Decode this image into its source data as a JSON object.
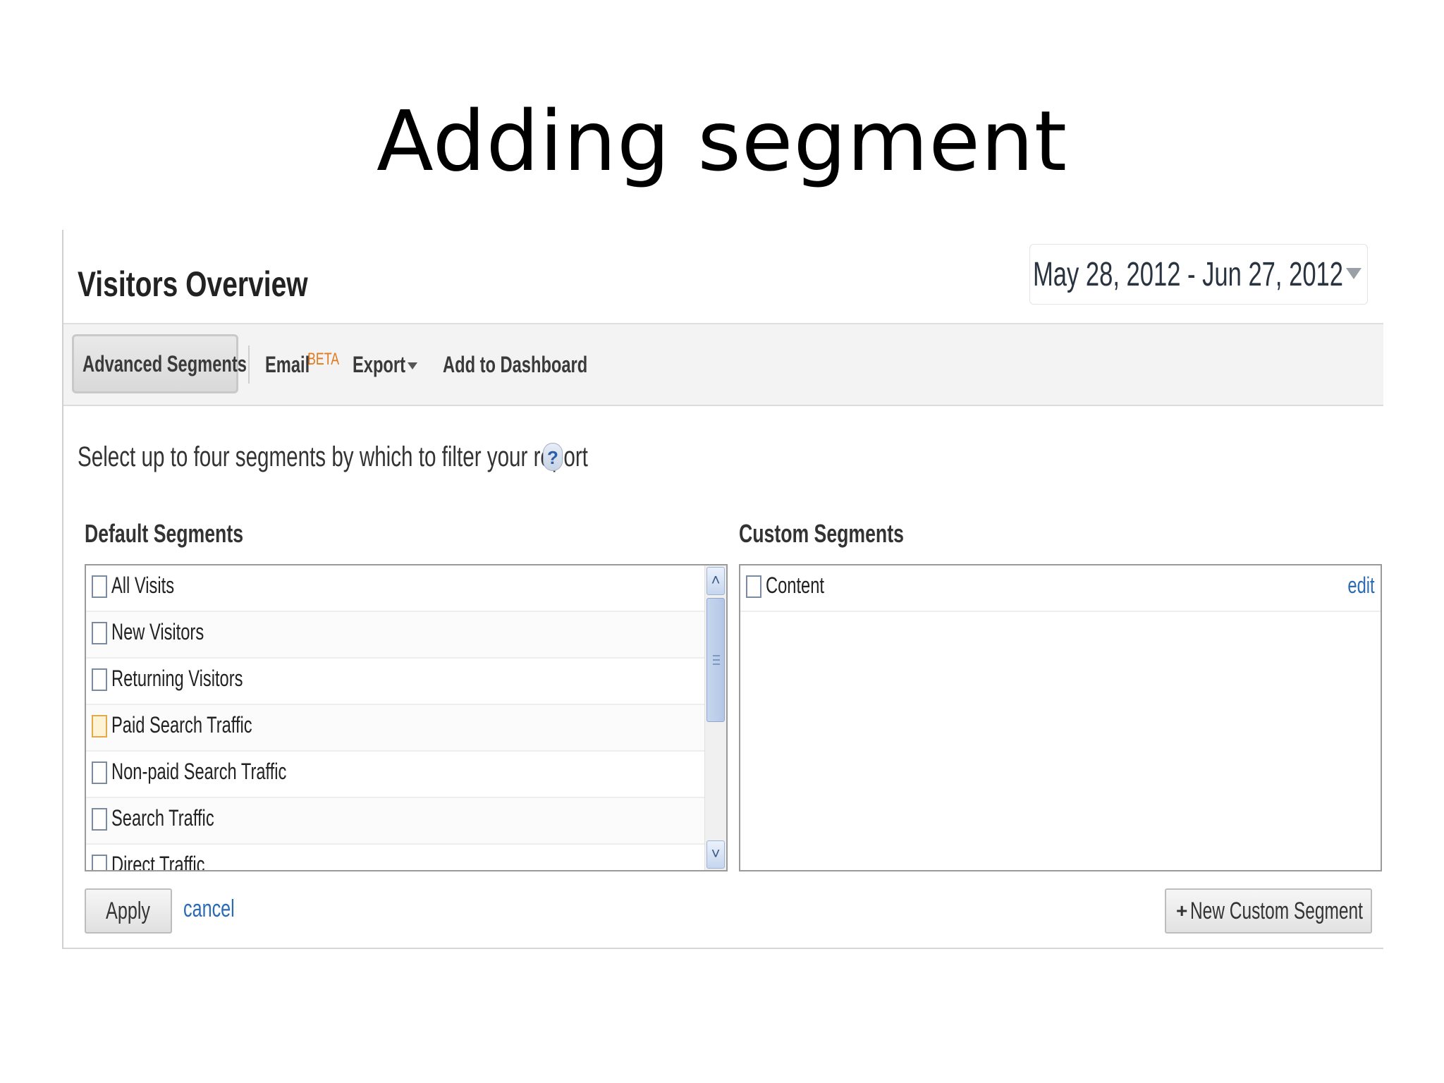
{
  "slide": {
    "title": "Adding segment"
  },
  "header": {
    "page_title": "Visitors Overview",
    "date_range": "May 28, 2012 - Jun 27, 2012"
  },
  "toolbar": {
    "advanced_segments": "Advanced Segments",
    "email": "Email",
    "email_badge": "BETA",
    "export": "Export",
    "add_to_dashboard": "Add to Dashboard"
  },
  "panel": {
    "instructions": "Select up to four segments by which to filter your report",
    "help_icon_glyph": "?",
    "default_label": "Default Segments",
    "custom_label": "Custom Segments",
    "default_segments": [
      {
        "label": "All Visits",
        "checked": false
      },
      {
        "label": "New Visitors",
        "checked": false
      },
      {
        "label": "Returning Visitors",
        "checked": false
      },
      {
        "label": "Paid Search Traffic",
        "checked": false,
        "hover": true
      },
      {
        "label": "Non-paid Search Traffic",
        "checked": false
      },
      {
        "label": "Search Traffic",
        "checked": false
      },
      {
        "label": "Direct Traffic",
        "checked": false
      }
    ],
    "custom_segments": [
      {
        "label": "Content",
        "checked": false,
        "edit_label": "edit"
      }
    ],
    "apply_label": "Apply",
    "cancel_label": "cancel",
    "new_custom_segment_plus": "+",
    "new_custom_segment_label": "New Custom Segment"
  },
  "colors": {
    "link": "#2a6bb3",
    "beta_badge": "#e07a1e",
    "toolbar_bg": "#f3f3f3",
    "hover_checkbox": "#e4a94a"
  },
  "icons": {
    "help": "help-icon",
    "date_dropdown": "chevron-down-icon",
    "export_dropdown": "chevron-down-icon",
    "scroll_up": "scroll-up-arrow-icon",
    "scroll_down": "scroll-down-arrow-icon",
    "add": "plus-icon"
  }
}
